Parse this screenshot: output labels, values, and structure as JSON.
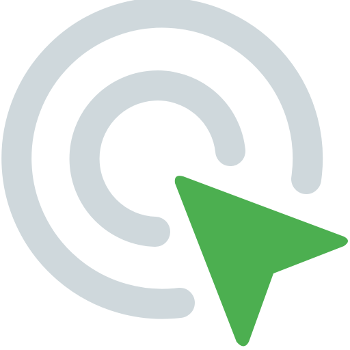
{
  "icon": {
    "name": "cursor-click-icon",
    "colors": {
      "rings": "#CFD8DC",
      "cursor": "#4CAF50",
      "background": "#FFFFFF"
    }
  }
}
